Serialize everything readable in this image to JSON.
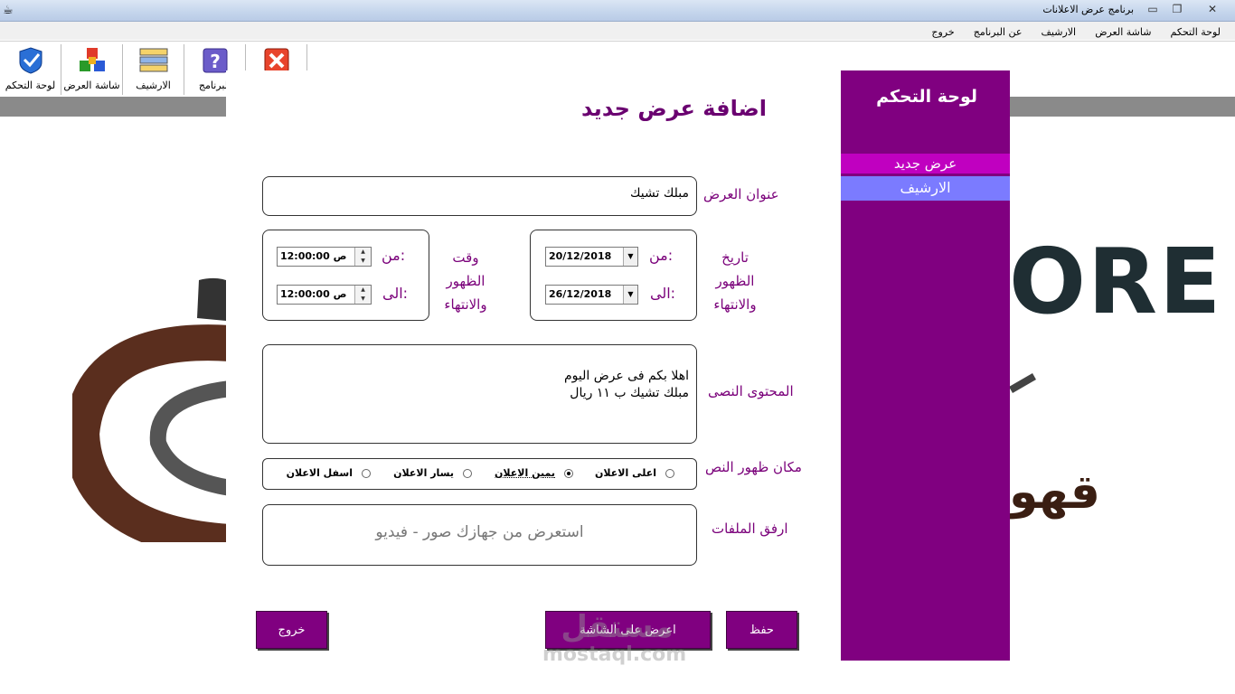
{
  "window": {
    "title": "برنامج عرض الاعلانات"
  },
  "menu": [
    "لوحة التحكم",
    "شاشة العرض",
    "الارشيف",
    "عن البرنامج",
    "خروج"
  ],
  "toolbar": [
    {
      "label": "لوحة التحكم",
      "icon": "shield-check-icon"
    },
    {
      "label": "شاشة العرض",
      "icon": "cubes-icon"
    },
    {
      "label": "الارشيف",
      "icon": "archive-stack-icon"
    },
    {
      "label": "البرنامج",
      "icon": "help-icon"
    },
    {
      "label": "",
      "icon": "exit-icon"
    }
  ],
  "background_logo": {
    "letters": "ORE",
    "arabic": "قهو"
  },
  "sidebar": {
    "title": "لوحة التحكم",
    "items": [
      {
        "label": "عرض جديد",
        "color": "#c000c0"
      },
      {
        "label": "الارشيف",
        "color": "#7b7bff"
      }
    ]
  },
  "form": {
    "title": "اضافة عرض جديد",
    "offer_title_label": "عنوان العرض",
    "offer_title_value": "مبلك تشيك",
    "date_label_1": "تاريخ",
    "date_label_2": "الظهور",
    "date_label_3": "والانتهاء",
    "time_label_1": "وقت",
    "time_label_2": "الظهور",
    "time_label_3": "والانتهاء",
    "from_label": "من:",
    "to_label": "الى:",
    "date_from": "20/12/2018",
    "date_to": "26/12/2018",
    "time_from": "12:00:00 ص",
    "time_to": "12:00:00 ص",
    "content_label": "المحتوى النصى",
    "content_line1": "اهلا بكم فى عرض اليوم",
    "content_line2": "مبلك تشيك ب ١١ ريال",
    "position_label": "مكان ظهور النص",
    "positions": [
      {
        "label": "اعلى الاعلان",
        "selected": false
      },
      {
        "label": "يمين الاعلان",
        "selected": true
      },
      {
        "label": "يسار الاعلان",
        "selected": false
      },
      {
        "label": "اسفل الاعلان",
        "selected": false
      }
    ],
    "attach_label": "ارفق الملفات",
    "attach_placeholder": "استعرض من جهازك صور - فيديو"
  },
  "buttons": {
    "save": "حفظ",
    "preview": "اعرض على الشاشة",
    "exit": "خروج"
  },
  "watermark": {
    "brand": "مستقل",
    "site": "mostaql.com"
  }
}
